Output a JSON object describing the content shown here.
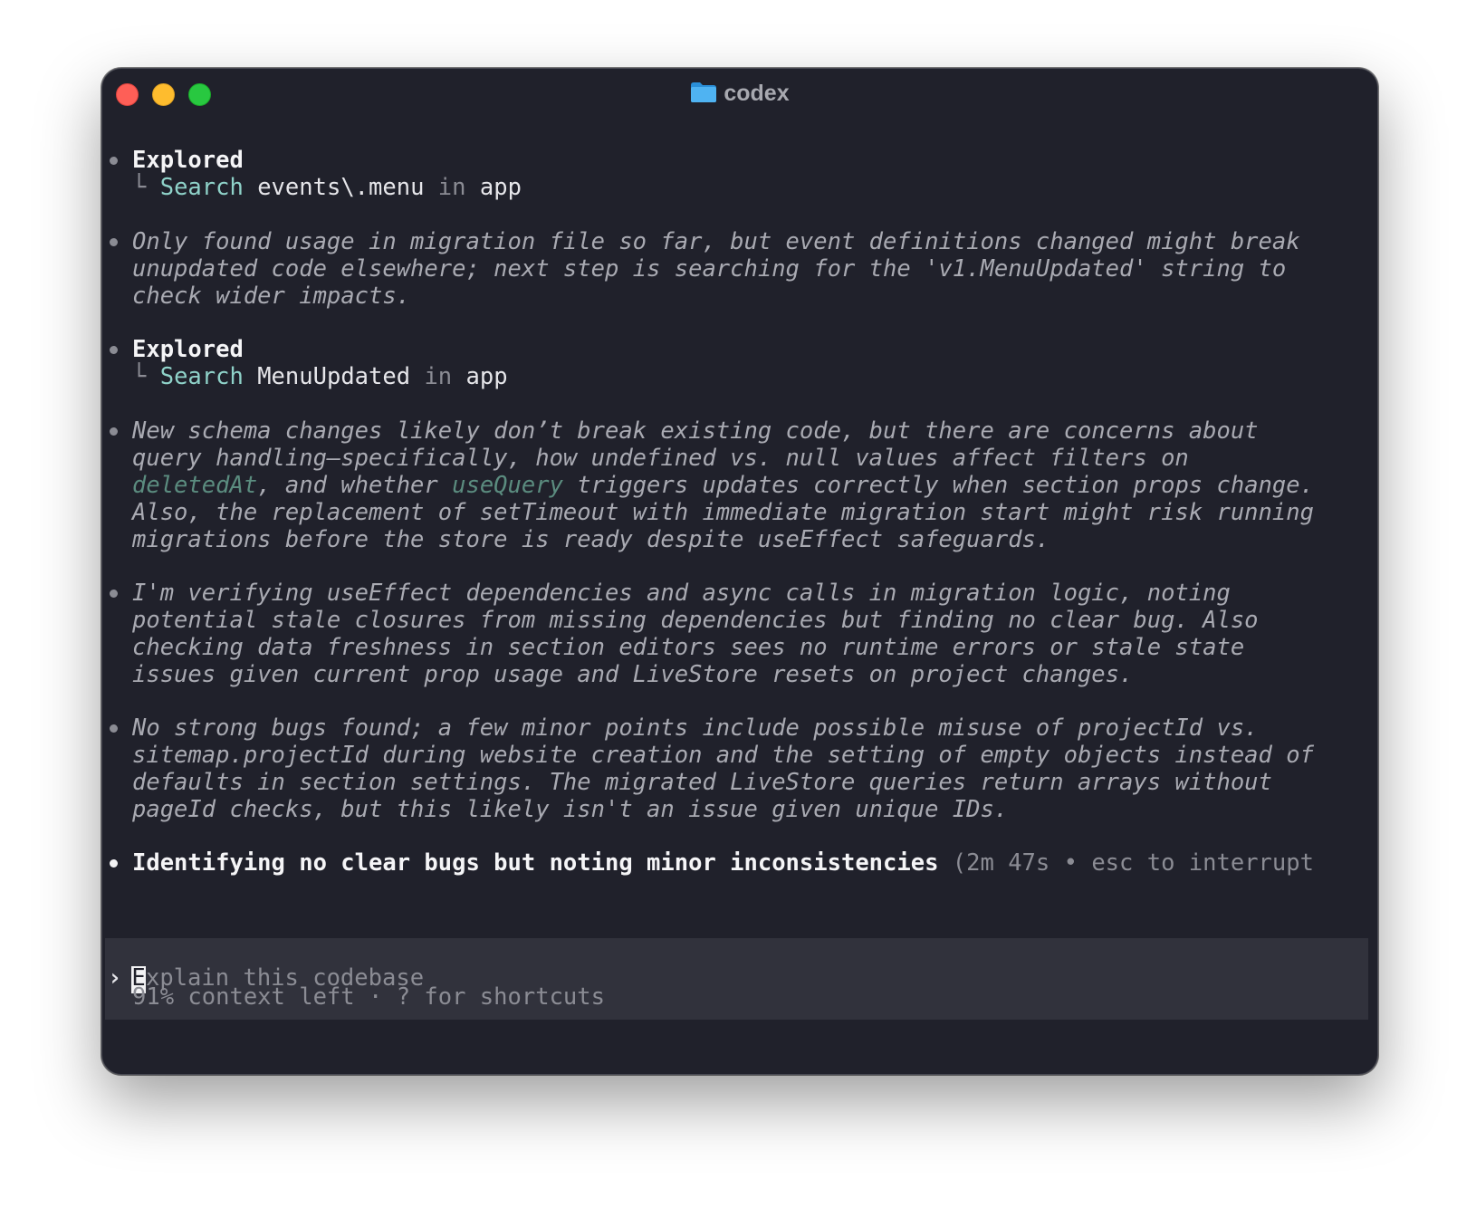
{
  "window": {
    "title": "codex",
    "title_icon": "folder-icon",
    "colors": {
      "background": "#20212b",
      "accent_cyan": "#8fd2c9",
      "input_background": "#31323c",
      "close": "#fe5f57",
      "minimize": "#febc2e",
      "maximize": "#28c840",
      "folder": "#3aa2e8"
    }
  },
  "log": {
    "explored1": {
      "heading": "Explored",
      "tree": "└",
      "action": "Search",
      "query": "events\\.menu",
      "in": "in",
      "target": "app"
    },
    "msg1": [
      "Only found usage in migration file so far, but event definitions changed might break",
      "unupdated code elsewhere; next step is searching for the 'v1.MenuUpdated' string to",
      "check wider impacts."
    ],
    "explored2": {
      "heading": "Explored",
      "tree": "└",
      "action": "Search",
      "query": "MenuUpdated",
      "in": "in",
      "target": "app"
    },
    "msg2": {
      "line1": "New schema changes likely don’t break existing code, but there are concerns about",
      "line2": "query handling—specifically, how undefined vs. null values affect filters on",
      "line3_code1": "deletedAt",
      "line3_mid": ", and whether ",
      "line3_code2": "useQuery",
      "line3_end": " triggers updates correctly when section props change.",
      "line4": "Also, the replacement of setTimeout with immediate migration start might risk running",
      "line5": "migrations before the store is ready despite useEffect safeguards."
    },
    "msg3": [
      "I'm verifying useEffect dependencies and async calls in migration logic, noting",
      "potential stale closures from missing dependencies but finding no clear bug. Also",
      "checking data freshness in section editors sees no runtime errors or stale state",
      "issues given current prop usage and LiveStore resets on project changes."
    ],
    "msg4": [
      "No strong bugs found; a few minor points include possible misuse of projectId vs.",
      "sitemap.projectId during website creation and the setting of empty objects instead of",
      "defaults in section settings. The migrated LiveStore queries return arrays without",
      "pageId checks, but this likely isn't an issue given unique IDs."
    ],
    "status": {
      "text": "Identifying no clear bugs but noting minor inconsistencies",
      "timer": " (2m 47s • esc to interrupt"
    }
  },
  "input": {
    "prompt_symbol": "›",
    "cursor_char": "E",
    "placeholder_rest": "xplain this codebase"
  },
  "footer": {
    "text": "91% context left · ? for shortcuts"
  }
}
